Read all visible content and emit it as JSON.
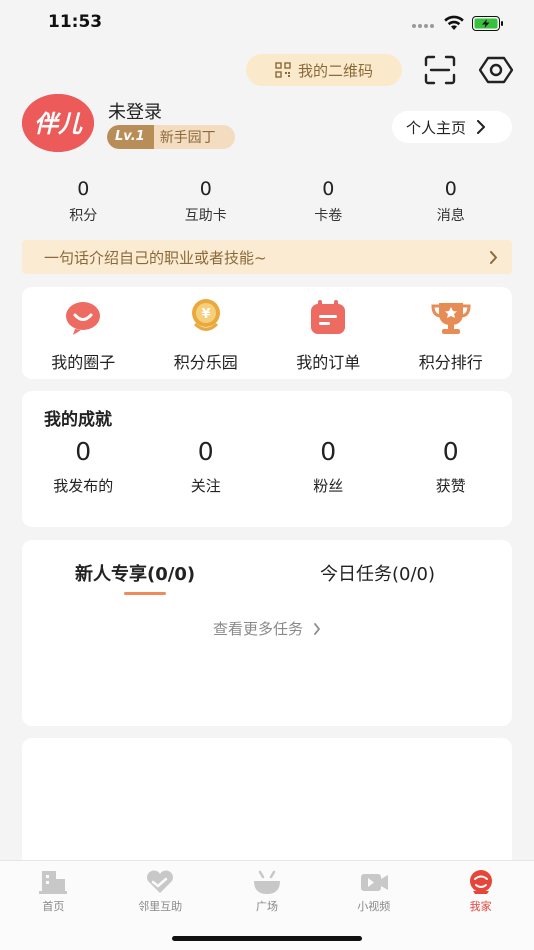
{
  "status": {
    "time": "11:53"
  },
  "header": {
    "qr_label": "我的二维码",
    "icons": [
      "qr-code-icon",
      "scan-icon",
      "eye-icon"
    ]
  },
  "profile": {
    "avatar_text": "伴儿",
    "username": "未登录",
    "level_tag": "Lv.1",
    "level_name": "新手园丁",
    "homepage_label": "个人主页"
  },
  "stats": [
    {
      "value": "0",
      "label": "积分"
    },
    {
      "value": "0",
      "label": "互助卡"
    },
    {
      "value": "0",
      "label": "卡卷"
    },
    {
      "value": "0",
      "label": "消息"
    }
  ],
  "intro_banner": {
    "text": "一句话介绍自己的职业或者技能~"
  },
  "quick_menu": [
    {
      "label": "我的圈子",
      "icon": "chat-bubble-icon",
      "color": "#ee6b62"
    },
    {
      "label": "积分乐园",
      "icon": "coin-medal-icon",
      "color": "#e9a93c"
    },
    {
      "label": "我的订单",
      "icon": "calendar-order-icon",
      "color": "#ee6b62"
    },
    {
      "label": "积分排行",
      "icon": "trophy-icon",
      "color": "#e88c55"
    }
  ],
  "achievements": {
    "title": "我的成就",
    "items": [
      {
        "value": "0",
        "label": "我发布的"
      },
      {
        "value": "0",
        "label": "关注"
      },
      {
        "value": "0",
        "label": "粉丝"
      },
      {
        "value": "0",
        "label": "获赞"
      }
    ]
  },
  "tasks": {
    "tabs": [
      {
        "label": "新人专享(0/0)",
        "active": true
      },
      {
        "label": "今日任务(0/0)",
        "active": false
      }
    ],
    "more_label": "查看更多任务"
  },
  "bottom_nav": [
    {
      "label": "首页",
      "icon": "building-icon",
      "active": false
    },
    {
      "label": "邻里互助",
      "icon": "heart-hands-icon",
      "active": false
    },
    {
      "label": "广场",
      "icon": "bowl-icon",
      "active": false
    },
    {
      "label": "小视频",
      "icon": "video-icon",
      "active": false
    },
    {
      "label": "我家",
      "icon": "home-avatar-icon",
      "active": true
    }
  ],
  "colors": {
    "accent": "#e6453a",
    "gold_text": "#8b6a3a",
    "banner_bg": "#faebd2",
    "tab_underline": "#ef8a5a"
  }
}
